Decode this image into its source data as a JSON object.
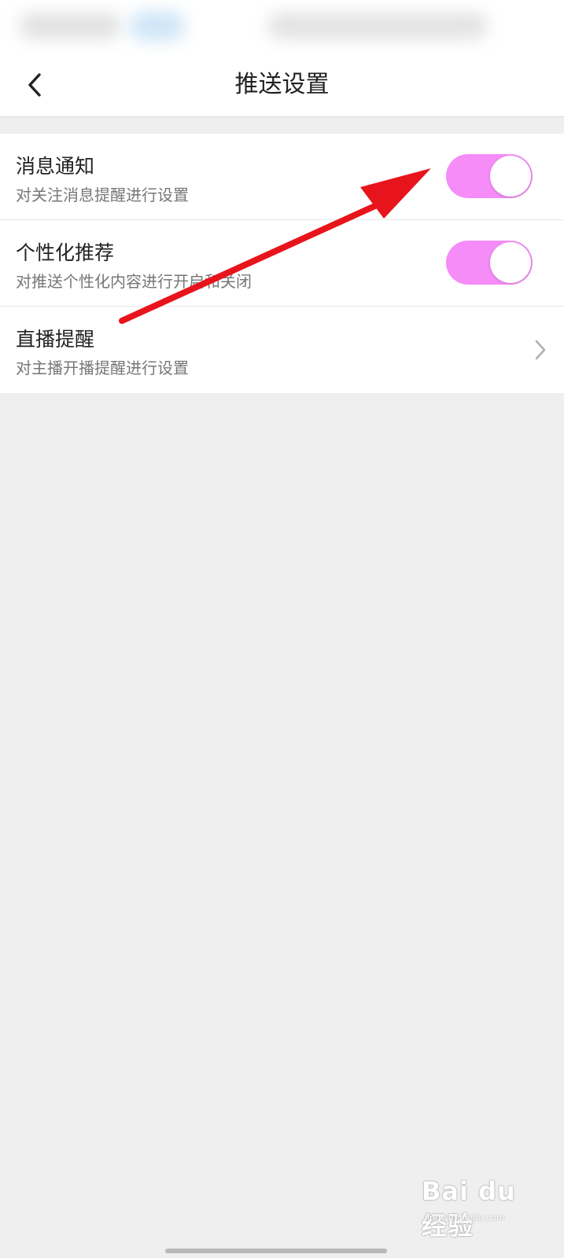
{
  "header": {
    "title": "推送设置"
  },
  "settings": [
    {
      "title": "消息通知",
      "subtitle": "对关注消息提醒进行设置",
      "control": "toggle",
      "enabled": true
    },
    {
      "title": "个性化推荐",
      "subtitle": "对推送个性化内容进行开启和关闭",
      "control": "toggle",
      "enabled": true
    },
    {
      "title": "直播提醒",
      "subtitle": "对主播开播提醒进行设置",
      "control": "chevron"
    }
  ],
  "watermark": {
    "logo_text": "Bai du 经验",
    "url": "jingyan.baidu.com"
  },
  "colors": {
    "toggle_on": "#f58cf7",
    "arrow": "#e8141c",
    "background": "#efefef"
  },
  "icons": {
    "back": "chevron-left-icon",
    "row_arrow": "chevron-right-icon"
  }
}
